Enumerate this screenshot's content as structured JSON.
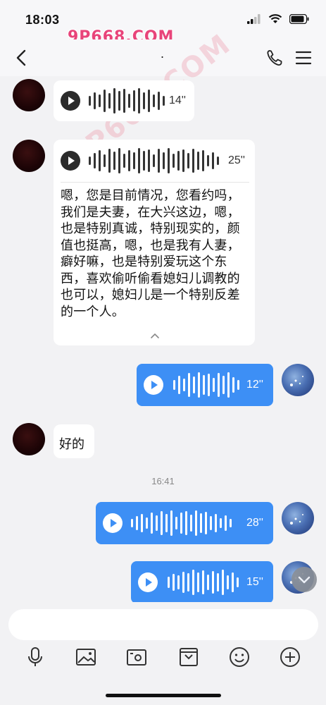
{
  "status_bar": {
    "time": "18:03"
  },
  "watermark_top": "9P668.COM",
  "watermark_diag": "9P668.COM",
  "nav": {
    "title": "."
  },
  "messages": {
    "voice1": {
      "duration": "14''"
    },
    "voice2": {
      "duration": "25''",
      "transcript": "嗯，您是目前情况，您看约吗，我们是夫妻，在大兴这边，嗯，也是特别真诚，特别现实的，颜值也挺高，嗯，也是我有人妻，癖好嘛，也是特别爱玩这个东西，喜欢偷听偷看媳妇儿调教的也可以，媳妇儿是一个特别反差的一个人。"
    },
    "voice3": {
      "duration": "12''"
    },
    "text1": "好的",
    "timestamp": "16:41",
    "voice4": {
      "duration": "28''"
    },
    "voice5": {
      "duration": "15''"
    }
  },
  "toolbar": {
    "icons": [
      "microphone-icon",
      "image-icon",
      "camera-icon",
      "folder-icon",
      "emoji-icon",
      "add-icon"
    ]
  },
  "colors": {
    "sent_bubble": "#3d8ff5",
    "received_bubble": "#ffffff",
    "background": "#f2f2f4"
  }
}
